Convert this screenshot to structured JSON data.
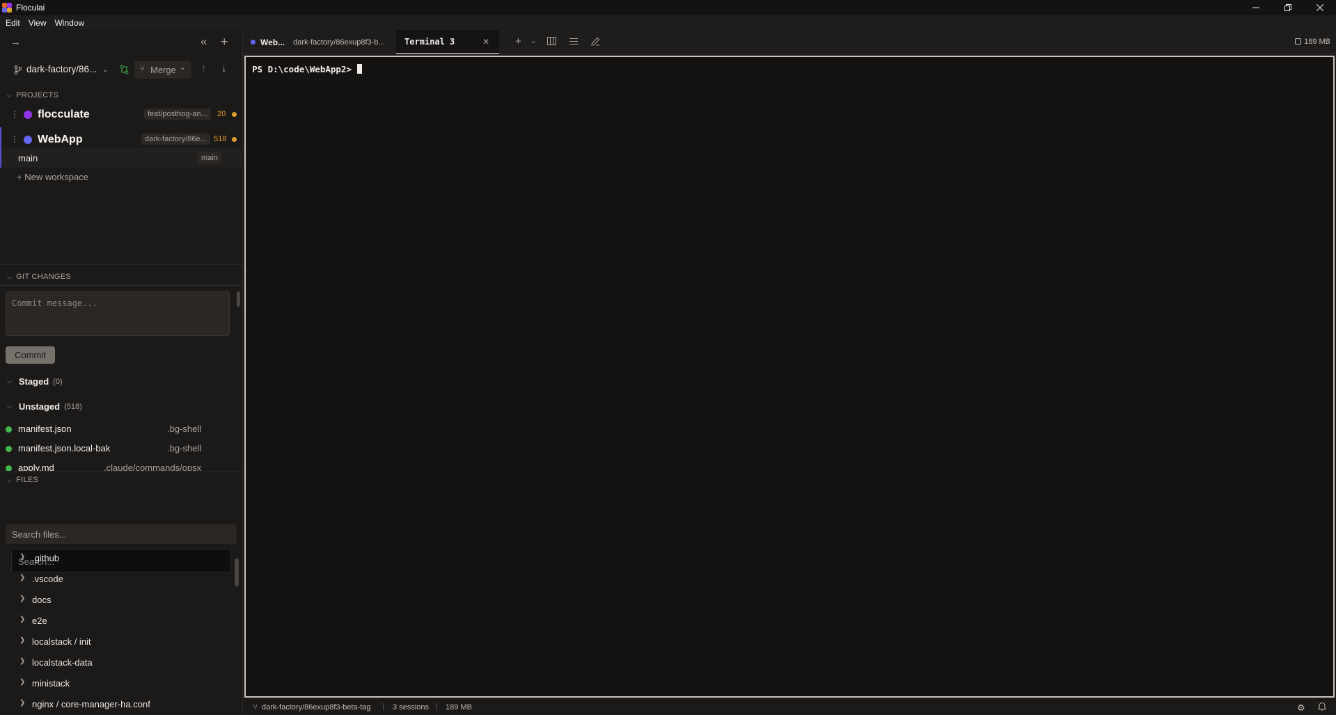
{
  "window": {
    "title": "Floculai",
    "controls": [
      "minimize",
      "restore",
      "close"
    ]
  },
  "menu": [
    "Edit",
    "View",
    "Window"
  ],
  "sidebar": {
    "branch": "dark-factory/86...",
    "merge_label": "Merge",
    "projects_header": "PROJECTS",
    "projects": [
      {
        "name": "flocculate",
        "branch": "feat/posthog-an...",
        "count": "20",
        "color": "#9333ea"
      },
      {
        "name": "WebApp",
        "branch": "dark-factory/86e...",
        "count": "518",
        "color": "#6366f1"
      }
    ],
    "workspace": {
      "name": "main",
      "tag": "main"
    },
    "new_workspace": "+ New workspace",
    "git_header": "GIT CHANGES",
    "commit_placeholder": "Commit message...",
    "commit_label": "Commit",
    "staged": {
      "label": "Staged",
      "count": "(0)"
    },
    "unstaged": {
      "label": "Unstaged",
      "count": "(518)"
    },
    "changed_files": [
      {
        "name": "manifest.json",
        "path": ".bg-shell"
      },
      {
        "name": "manifest.json.local-bak",
        "path": ".bg-shell"
      },
      {
        "name": "apply.md",
        "path": ".claude/commands/opsx"
      }
    ],
    "files_header": "FILES",
    "search_files_placeholder": "Search files...",
    "search_placeholder": "Search...",
    "tree": [
      ".github",
      ".vscode",
      "docs",
      "e2e",
      "localstack / init",
      "localstack-data",
      "ministack",
      "nginx / core-manager-ha.conf"
    ]
  },
  "tabs": {
    "project_tab": {
      "project": "Web...",
      "branch": "dark-factory/86exup8f3-b..."
    },
    "terminal_tab": {
      "label": "Terminal 3"
    },
    "memory": "189 MB"
  },
  "terminal": {
    "prompt": "PS D:\\code\\WebApp2>"
  },
  "statusbar": {
    "branch": "dark-factory/86exup8f3-beta-tag",
    "sessions": "3 sessions",
    "memory": "189 MB"
  }
}
